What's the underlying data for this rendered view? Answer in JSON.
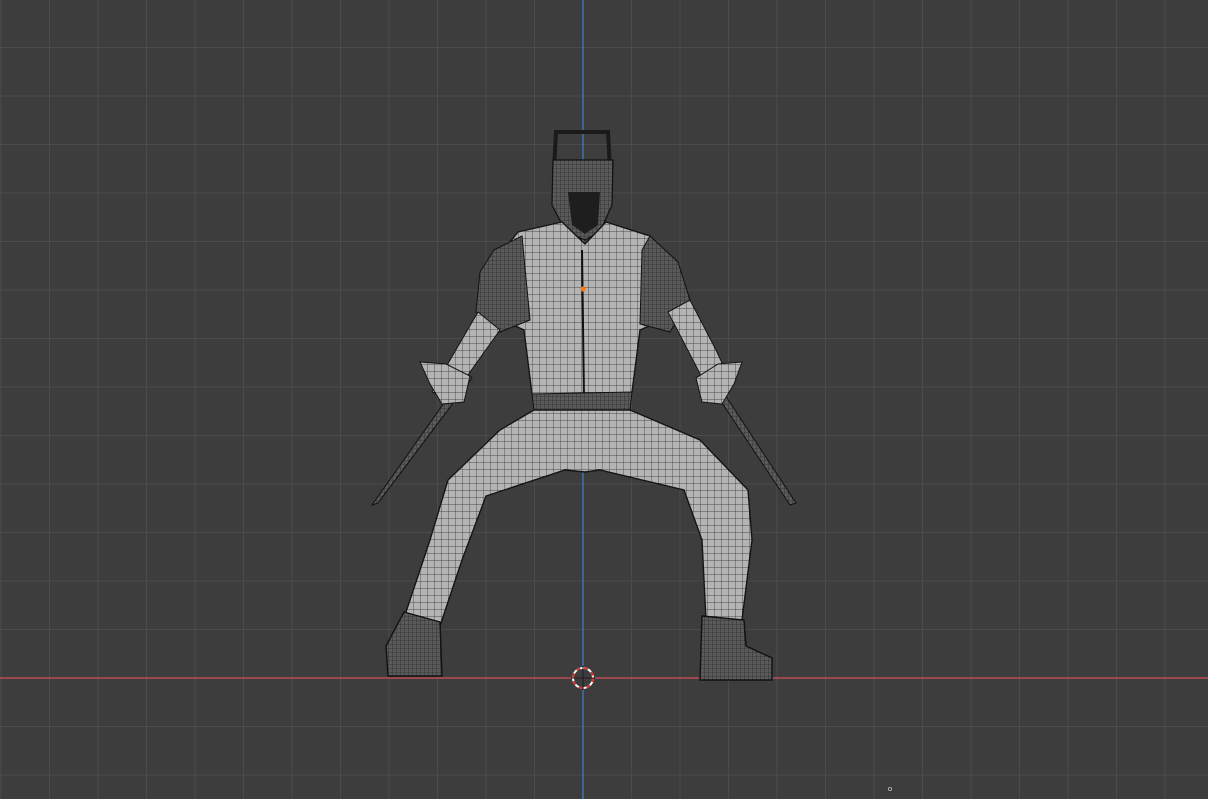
{
  "viewport": {
    "view": "front-orthographic",
    "mode": "wireframe-overlay",
    "background_color": "#3d3d3d",
    "grid_color": "#4b4b4b",
    "x_axis_color": "#d2505a",
    "z_axis_color": "#3f7fc9",
    "mesh_fill_color": "#b4b4b4",
    "mesh_wire_color": "#1e1e1e",
    "origin_color": "#f07a1c"
  },
  "scene_objects": [
    {
      "name": "character-mesh",
      "selected": false
    },
    {
      "name": "3d-cursor"
    },
    {
      "name": "object-origin"
    }
  ]
}
